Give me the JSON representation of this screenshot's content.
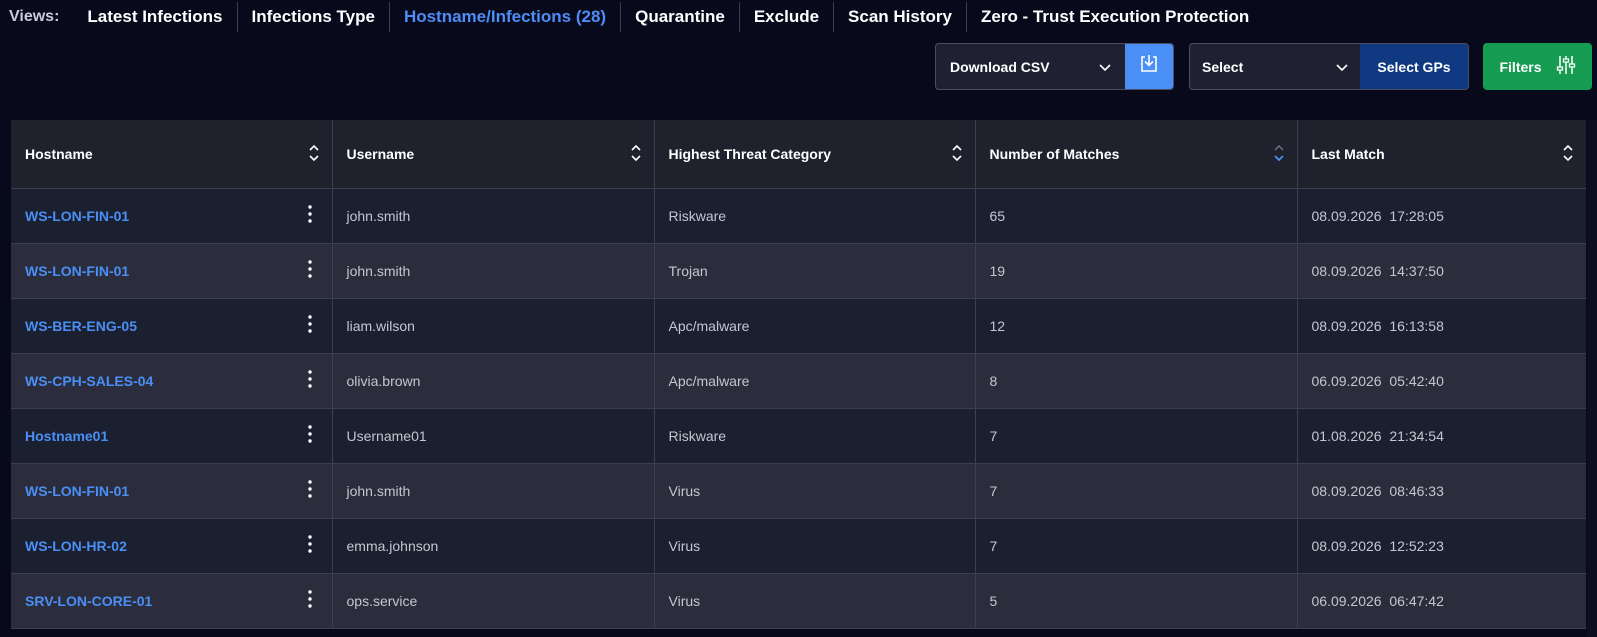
{
  "views": {
    "label": "Views:",
    "tabs": [
      {
        "label": "Latest Infections",
        "active": false
      },
      {
        "label": "Infections Type",
        "active": false
      },
      {
        "label": "Hostname/Infections (28)",
        "active": true
      },
      {
        "label": "Quarantine",
        "active": false
      },
      {
        "label": "Exclude",
        "active": false
      },
      {
        "label": "Scan History",
        "active": false
      },
      {
        "label": "Zero - Trust Execution Protection",
        "active": false
      }
    ]
  },
  "toolbar": {
    "csv_label": "Download CSV",
    "gp_select_label": "Select",
    "gp_button_label": "Select GPs",
    "filters_label": "Filters"
  },
  "colors": {
    "accent": "#4a8ff5",
    "filters_green": "#169b53",
    "gp_blue": "#0f3a82"
  },
  "table": {
    "columns": [
      "Hostname",
      "Username",
      "Highest Threat Category",
      "Number of Matches",
      "Last Match"
    ],
    "sorted_column": "Number of Matches",
    "rows": [
      {
        "hostname": "WS-LON-FIN-01",
        "username": "john.smith",
        "category": "Riskware",
        "matches": "65",
        "date": "08.09.2026",
        "time": "17:28:05"
      },
      {
        "hostname": "WS-LON-FIN-01",
        "username": "john.smith",
        "category": "Trojan",
        "matches": "19",
        "date": "08.09.2026",
        "time": "14:37:50"
      },
      {
        "hostname": "WS-BER-ENG-05",
        "username": "liam.wilson",
        "category": "Apc/malware",
        "matches": "12",
        "date": "08.09.2026",
        "time": "16:13:58"
      },
      {
        "hostname": "WS-CPH-SALES-04",
        "username": "olivia.brown",
        "category": "Apc/malware",
        "matches": "8",
        "date": "06.09.2026",
        "time": "05:42:40"
      },
      {
        "hostname": "Hostname01",
        "username": "Username01",
        "category": "Riskware",
        "matches": "7",
        "date": "01.08.2026",
        "time": "21:34:54"
      },
      {
        "hostname": "WS-LON-FIN-01",
        "username": "john.smith",
        "category": "Virus",
        "matches": "7",
        "date": "08.09.2026",
        "time": "08:46:33"
      },
      {
        "hostname": "WS-LON-HR-02",
        "username": "emma.johnson",
        "category": "Virus",
        "matches": "7",
        "date": "08.09.2026",
        "time": "12:52:23"
      },
      {
        "hostname": "SRV-LON-CORE-01",
        "username": "ops.service",
        "category": "Virus",
        "matches": "5",
        "date": "06.09.2026",
        "time": "06:47:42"
      }
    ]
  }
}
